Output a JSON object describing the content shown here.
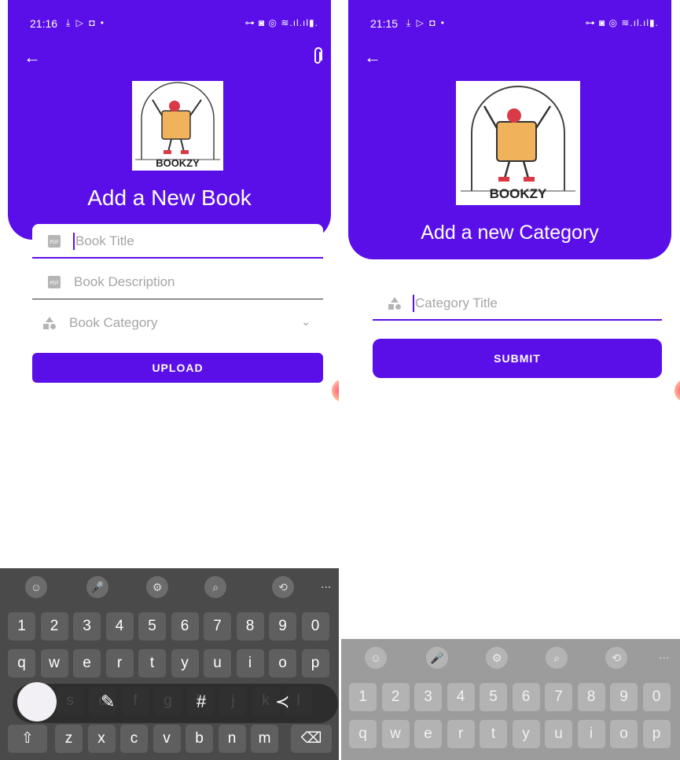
{
  "left": {
    "status": {
      "time": "21:16",
      "icons_left": "⤓ ▷ ◘ •",
      "icons_right": "⊶ ◙ ◎ ≋.ıl.ıl▮."
    },
    "title": "Add a New Book",
    "logo_text": "BOOKZY",
    "fields": {
      "title_placeholder": "Book Title",
      "description_placeholder": "Book Description",
      "category_placeholder": "Book Category"
    },
    "upload_label": "UPLOAD",
    "keyboard": {
      "numbers": [
        "1",
        "2",
        "3",
        "4",
        "5",
        "6",
        "7",
        "8",
        "9",
        "0"
      ],
      "row1": [
        "q",
        "w",
        "e",
        "r",
        "t",
        "y",
        "u",
        "i",
        "o",
        "p"
      ],
      "row2": [
        "a",
        "s",
        "d",
        "f",
        "g",
        "h",
        "j",
        "k",
        "l"
      ],
      "row3": [
        "z",
        "x",
        "c",
        "v",
        "b",
        "n",
        "m"
      ],
      "more": "..."
    }
  },
  "right": {
    "status": {
      "time": "21:15",
      "icons_left": "⤓ ▷ ◘ •",
      "icons_right": "⊶ ◙ ◎ ≋.ıl.ıl▮."
    },
    "title": "Add a new Category",
    "logo_text": "BOOKZY",
    "fields": {
      "category_title_placeholder": "Category Title"
    },
    "submit_label": "SUBMIT",
    "keyboard": {
      "numbers": [
        "1",
        "2",
        "3",
        "4",
        "5",
        "6",
        "7",
        "8",
        "9",
        "0"
      ],
      "row1": [
        "q",
        "w",
        "e",
        "r",
        "t",
        "y",
        "u",
        "i",
        "o",
        "p"
      ],
      "more": "..."
    }
  },
  "colors": {
    "primary": "#5a0fe8",
    "placeholder": "#a5a5a5",
    "divider": "#333333"
  }
}
